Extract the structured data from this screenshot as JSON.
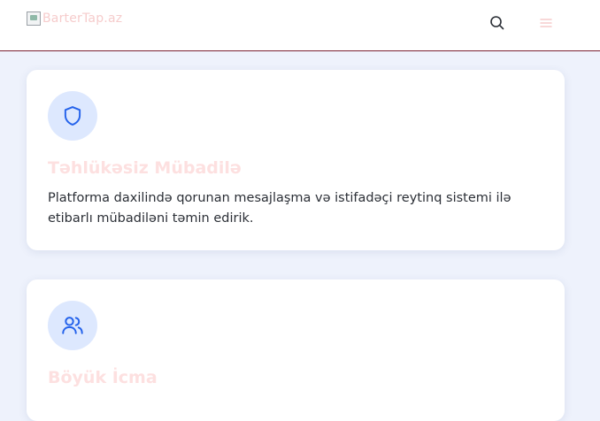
{
  "header": {
    "logo_alt": "BarterTap.az",
    "search_icon": "search-icon",
    "menu_icon": "hamburger-menu-icon"
  },
  "cards": [
    {
      "icon": "shield-icon",
      "title": "Təhlükəsiz Mübadilə",
      "text": "Platforma daxilində qorunan mesajlaşma və istifadəçi reytinq sistemi ilə etibarlı mübadiləni təmin edirik."
    },
    {
      "icon": "users-icon",
      "title": "Böyük İcma",
      "text": ""
    }
  ],
  "colors": {
    "accent": "#2563eb",
    "icon_bg": "#dde8fe",
    "title": "#fde0e0",
    "header_border": "#7a2030",
    "page_bg": "#eef2fc"
  }
}
